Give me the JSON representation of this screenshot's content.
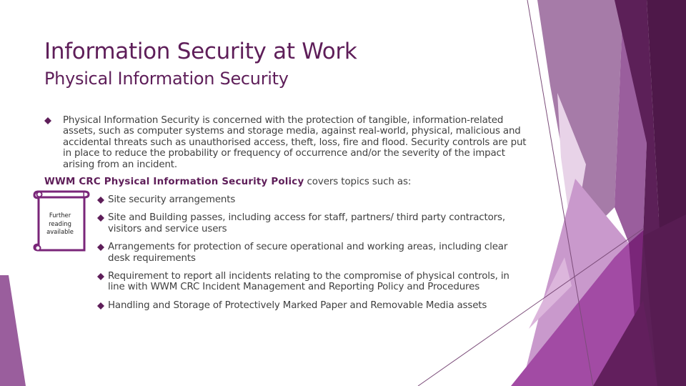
{
  "slide": {
    "title": "Information Security at Work",
    "subtitle": "Physical Information Security",
    "intro_bullet": "Physical Information Security is concerned with the protection of tangible, information-related assets, such as computer systems and storage media, against real-world, physical, malicious and accidental threats such as unauthorised access, theft, loss, fire and flood.  Security controls are put in place to reduce the probability or frequency of occurrence and/or the severity of the impact arising from an incident.",
    "policy_name": "WWM CRC Physical Information Security Policy",
    "policy_suffix": " covers topics such as:",
    "topics": [
      "Site security arrangements",
      "Site and Building passes, including access for staff, partners/ third party contractors, visitors and service users",
      "Arrangements for protection of secure operational and working areas, including clear desk requirements",
      "Requirement to report all incidents relating to the compromise of physical controls, in line with WWM CRC Incident Management and Reporting Policy and Procedures",
      "Handling and Storage of Protectively Marked Paper and Removable Media assets"
    ],
    "scroll_note": "Further reading available",
    "icons": {
      "bullet": "diamond-bullet-icon",
      "note": "scroll-icon"
    }
  },
  "theme": {
    "accent": "#5e1e59",
    "bullet": "#5e1e59",
    "text": "#404040",
    "facet_colors": [
      "#a67ba8",
      "#9a5e9d",
      "#c999cc",
      "#e3cae3",
      "#a24ba4",
      "#7a2679",
      "#5a1e57",
      "#4e1849"
    ]
  }
}
